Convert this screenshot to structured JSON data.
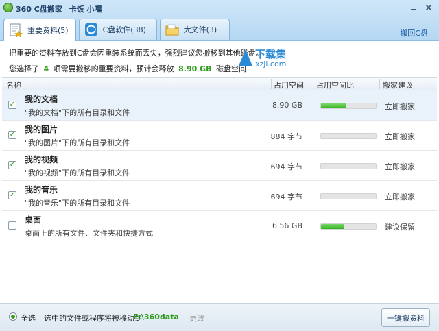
{
  "app": {
    "title": "360 C盘搬家",
    "subtitle": "卡饭 小嘿"
  },
  "tabs": [
    {
      "label": "重要资料(5)",
      "icon": "documents-folder-icon",
      "active": true
    },
    {
      "label": "C盘软件(38)",
      "icon": "c-drive-software-icon",
      "active": false
    },
    {
      "label": "大文件(3)",
      "icon": "big-files-folder-icon",
      "active": false
    }
  ],
  "move_back_link": "搬回C盘",
  "info": {
    "line1": "把重要的资料存放到C盘会因重装系统而丢失，强烈建议您搬移到其他磁盘。",
    "line2_prefix": "您选择了",
    "line2_count": "4",
    "line2_mid": "项需要搬移的重要资料，预计会释放",
    "line2_size": "8.90 GB",
    "line2_suffix": "磁盘空间"
  },
  "watermark": {
    "text_cn": "下载集",
    "text_en": "xzji.com"
  },
  "table": {
    "columns": {
      "name": "名称",
      "size": "占用空间",
      "ratio": "占用空间比",
      "advice": "搬家建议"
    },
    "rows": [
      {
        "title": "我的文档",
        "desc": "\"我的文档\"下的所有目录和文件",
        "size": "8.90 GB",
        "ratio": 0.45,
        "advice": "立即搬家",
        "checked": true,
        "selected": true
      },
      {
        "title": "我的图片",
        "desc": "\"我的图片\"下的所有目录和文件",
        "size": "884 字节",
        "ratio": 0.0,
        "advice": "立即搬家",
        "checked": true,
        "selected": false
      },
      {
        "title": "我的视频",
        "desc": "\"我的视频\"下的所有目录和文件",
        "size": "694 字节",
        "ratio": 0.0,
        "advice": "立即搬家",
        "checked": true,
        "selected": false
      },
      {
        "title": "我的音乐",
        "desc": "\"我的音乐\"下的所有目录和文件",
        "size": "694 字节",
        "ratio": 0.0,
        "advice": "立即搬家",
        "checked": true,
        "selected": false
      },
      {
        "title": "桌面",
        "desc": "桌面上的所有文件、文件夹和快捷方式",
        "size": "6.56 GB",
        "ratio": 0.42,
        "advice": "建议保留",
        "checked": false,
        "selected": false
      }
    ]
  },
  "footer": {
    "select_all": "全选",
    "move_text": "选中的文件或程序将被移动到",
    "move_path": "E:\\360data",
    "change": "更改",
    "one_key_button": "一键搬资料"
  },
  "colors": {
    "accent_green": "#2d9c1a",
    "link_blue": "#1a5ea8",
    "tab_bg": "#c9e1f5"
  }
}
